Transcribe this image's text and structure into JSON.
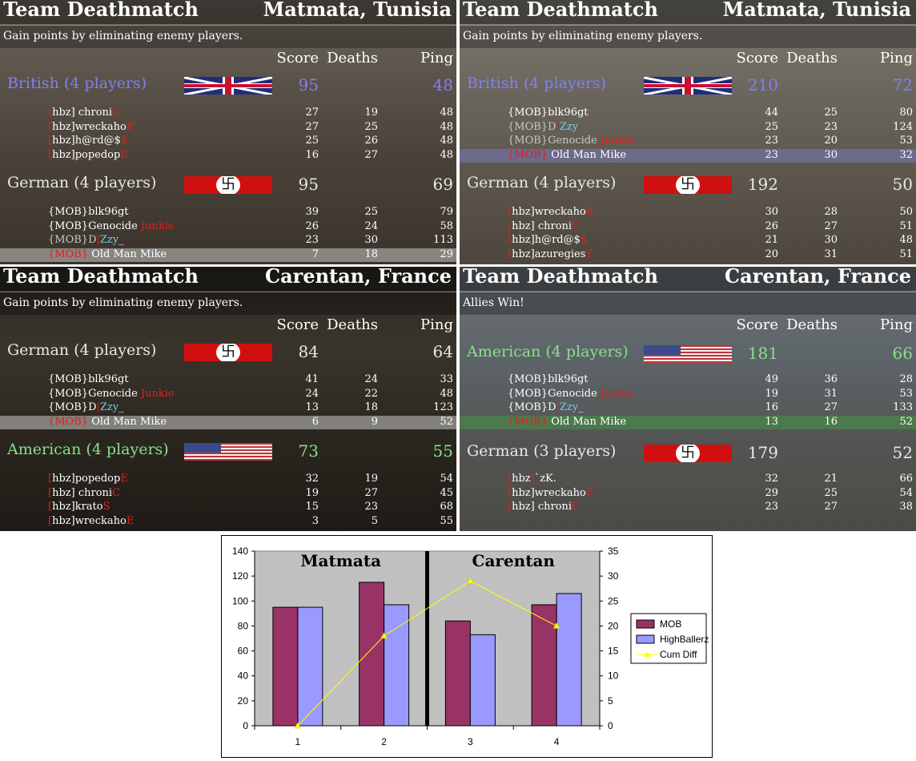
{
  "panels": [
    {
      "mode": "Team Deathmatch",
      "map": "Matmata, Tunisia",
      "subtitle": "Gain points by eliminating enemy players.",
      "cols": {
        "score": "Score",
        "deaths": "Deaths",
        "ping": "Ping"
      },
      "teams": [
        {
          "name": "British (4 players)",
          "color": "#8080f0",
          "flag": "uk",
          "score": "95",
          "ping": "48",
          "players": [
            {
              "parts": [
                [
                  "[",
                  "red"
                ],
                [
                  "hbz",
                  "wht"
                ],
                [
                  "] chroni",
                  "wht"
                ],
                [
                  "C",
                  "red"
                ]
              ],
              "score": "27",
              "deaths": "19",
              "ping": "48",
              "hl": ""
            },
            {
              "parts": [
                [
                  "[",
                  "red"
                ],
                [
                  "hbz",
                  "wht"
                ],
                [
                  "]wreckaho",
                  "wht"
                ],
                [
                  "E",
                  "red"
                ]
              ],
              "score": "27",
              "deaths": "25",
              "ping": "48",
              "hl": ""
            },
            {
              "parts": [
                [
                  "[",
                  "red"
                ],
                [
                  "hbz",
                  "wht"
                ],
                [
                  "]h@rd@$",
                  "wht"
                ],
                [
                  "$",
                  "red"
                ]
              ],
              "score": "25",
              "deaths": "26",
              "ping": "48",
              "hl": ""
            },
            {
              "parts": [
                [
                  "[",
                  "red"
                ],
                [
                  "hbz",
                  "wht"
                ],
                [
                  "]popedop",
                  "wht"
                ],
                [
                  "E",
                  "red"
                ]
              ],
              "score": "16",
              "deaths": "27",
              "ping": "48",
              "hl": ""
            }
          ]
        },
        {
          "name": "German (4 players)",
          "color": "#e8e8e8",
          "flag": "de",
          "score": "95",
          "ping": "69",
          "players": [
            {
              "parts": [
                [
                  "{MOB}blk96gt",
                  "wht"
                ]
              ],
              "score": "39",
              "deaths": "25",
              "ping": "79",
              "hl": ""
            },
            {
              "parts": [
                [
                  "{MOB}Genocide ",
                  "wht"
                ],
                [
                  "Junkie",
                  "red"
                ]
              ],
              "score": "26",
              "deaths": "24",
              "ping": "58",
              "hl": ""
            },
            {
              "parts": [
                [
                  "{MOB}D",
                  "gry"
                ],
                [
                  "|",
                  "red"
                ],
                [
                  "Zzy",
                  "cyan"
                ],
                [
                  "_",
                  "wht"
                ]
              ],
              "score": "23",
              "deaths": "30",
              "ping": "113",
              "hl": ""
            },
            {
              "parts": [
                [
                  "{MOB}",
                  "red"
                ],
                [
                  " Old Man Mike",
                  "wht"
                ]
              ],
              "score": "7",
              "deaths": "18",
              "ping": "29",
              "hl": "grey"
            }
          ]
        }
      ]
    },
    {
      "mode": "Team Deathmatch",
      "map": "Matmata, Tunisia",
      "subtitle": "Gain points by eliminating enemy players.",
      "cols": {
        "score": "Score",
        "deaths": "Deaths",
        "ping": "Ping"
      },
      "teams": [
        {
          "name": "British (4 players)",
          "color": "#8080f0",
          "flag": "uk",
          "score": "210",
          "ping": "72",
          "players": [
            {
              "parts": [
                [
                  "{MOB}blk96gt",
                  "wht"
                ]
              ],
              "score": "44",
              "deaths": "25",
              "ping": "80",
              "hl": ""
            },
            {
              "parts": [
                [
                  "{MOB}D",
                  "gry"
                ],
                [
                  "|",
                  "red"
                ],
                [
                  "Zzy",
                  "cyan"
                ]
              ],
              "score": "25",
              "deaths": "23",
              "ping": "124",
              "hl": ""
            },
            {
              "parts": [
                [
                  "{MOB}Genocide ",
                  "gry"
                ],
                [
                  "Junkie",
                  "red"
                ]
              ],
              "score": "23",
              "deaths": "20",
              "ping": "53",
              "hl": ""
            },
            {
              "parts": [
                [
                  "{MOB}",
                  "red"
                ],
                [
                  " Old Man Mike",
                  "wht"
                ]
              ],
              "score": "23",
              "deaths": "30",
              "ping": "32",
              "hl": "blue"
            }
          ]
        },
        {
          "name": "German (4 players)",
          "color": "#e8e8e8",
          "flag": "de",
          "score": "192",
          "ping": "50",
          "players": [
            {
              "parts": [
                [
                  "[",
                  "red"
                ],
                [
                  "hbz",
                  "wht"
                ],
                [
                  "]wreckaho",
                  "wht"
                ],
                [
                  "E",
                  "red"
                ]
              ],
              "score": "30",
              "deaths": "28",
              "ping": "50",
              "hl": ""
            },
            {
              "parts": [
                [
                  "[",
                  "red"
                ],
                [
                  "hbz",
                  "wht"
                ],
                [
                  "] chroni",
                  "wht"
                ],
                [
                  "C",
                  "red"
                ]
              ],
              "score": "26",
              "deaths": "27",
              "ping": "51",
              "hl": ""
            },
            {
              "parts": [
                [
                  "[",
                  "red"
                ],
                [
                  "hbz",
                  "wht"
                ],
                [
                  "]h@rd@$",
                  "wht"
                ],
                [
                  "$",
                  "red"
                ]
              ],
              "score": "21",
              "deaths": "30",
              "ping": "48",
              "hl": ""
            },
            {
              "parts": [
                [
                  "[",
                  "red"
                ],
                [
                  "hbz",
                  "wht"
                ],
                [
                  "]azuregies",
                  "wht"
                ],
                [
                  "T",
                  "red"
                ]
              ],
              "score": "20",
              "deaths": "31",
              "ping": "51",
              "hl": ""
            }
          ]
        }
      ]
    },
    {
      "mode": "Team Deathmatch",
      "map": "Carentan, France",
      "subtitle": "Gain points by eliminating enemy players.",
      "cols": {
        "score": "Score",
        "deaths": "Deaths",
        "ping": "Ping"
      },
      "teams": [
        {
          "name": "German (4 players)",
          "color": "#e8e8e8",
          "flag": "de",
          "score": "84",
          "ping": "64",
          "players": [
            {
              "parts": [
                [
                  "{MOB}blk96gt",
                  "wht"
                ]
              ],
              "score": "41",
              "deaths": "24",
              "ping": "33",
              "hl": ""
            },
            {
              "parts": [
                [
                  "{MOB}Genocide ",
                  "wht"
                ],
                [
                  "Junkie",
                  "red"
                ]
              ],
              "score": "24",
              "deaths": "22",
              "ping": "48",
              "hl": ""
            },
            {
              "parts": [
                [
                  "{MOB}D",
                  "wht"
                ],
                [
                  "|",
                  "red"
                ],
                [
                  "Zzy",
                  "cyan"
                ],
                [
                  "_",
                  "wht"
                ]
              ],
              "score": "13",
              "deaths": "18",
              "ping": "123",
              "hl": ""
            },
            {
              "parts": [
                [
                  "{MOB}",
                  "red"
                ],
                [
                  " Old Man Mike",
                  "wht"
                ]
              ],
              "score": "6",
              "deaths": "9",
              "ping": "52",
              "hl": "grey"
            }
          ]
        },
        {
          "name": "American (4 players)",
          "color": "#88e088",
          "flag": "us",
          "score": "73",
          "ping": "55",
          "players": [
            {
              "parts": [
                [
                  "[",
                  "red"
                ],
                [
                  "hbz",
                  "wht"
                ],
                [
                  "]popedop",
                  "wht"
                ],
                [
                  "E",
                  "red"
                ]
              ],
              "score": "32",
              "deaths": "19",
              "ping": "54",
              "hl": ""
            },
            {
              "parts": [
                [
                  "[",
                  "red"
                ],
                [
                  "hbz",
                  "wht"
                ],
                [
                  "] chroni",
                  "wht"
                ],
                [
                  "C",
                  "red"
                ]
              ],
              "score": "19",
              "deaths": "27",
              "ping": "45",
              "hl": ""
            },
            {
              "parts": [
                [
                  "[",
                  "red"
                ],
                [
                  "hbz",
                  "wht"
                ],
                [
                  "]krato",
                  "wht"
                ],
                [
                  "S",
                  "red"
                ]
              ],
              "score": "15",
              "deaths": "23",
              "ping": "68",
              "hl": ""
            },
            {
              "parts": [
                [
                  "[",
                  "red"
                ],
                [
                  "hbz",
                  "wht"
                ],
                [
                  "]wreckaho",
                  "wht"
                ],
                [
                  "E",
                  "red"
                ]
              ],
              "score": "3",
              "deaths": "5",
              "ping": "55",
              "hl": ""
            }
          ]
        }
      ]
    },
    {
      "mode": "Team Deathmatch",
      "map": "Carentan, France",
      "subtitle": "Allies Win!",
      "cols": {
        "score": "Score",
        "deaths": "Deaths",
        "ping": "Ping"
      },
      "teams": [
        {
          "name": "American (4 players)",
          "color": "#88e088",
          "flag": "us",
          "score": "181",
          "ping": "66",
          "players": [
            {
              "parts": [
                [
                  "{MOB}blk96gt",
                  "wht"
                ]
              ],
              "score": "49",
              "deaths": "36",
              "ping": "28",
              "hl": ""
            },
            {
              "parts": [
                [
                  "{MOB}Genocide ",
                  "wht"
                ],
                [
                  "Junkie",
                  "red"
                ]
              ],
              "score": "19",
              "deaths": "31",
              "ping": "53",
              "hl": ""
            },
            {
              "parts": [
                [
                  "{MOB}D",
                  "wht"
                ],
                [
                  "|",
                  "red"
                ],
                [
                  "Zzy",
                  "cyan"
                ],
                [
                  "_",
                  "wht"
                ]
              ],
              "score": "16",
              "deaths": "27",
              "ping": "133",
              "hl": ""
            },
            {
              "parts": [
                [
                  "{MOB}",
                  "red"
                ],
                [
                  " Old Man Mike",
                  "wht"
                ]
              ],
              "score": "13",
              "deaths": "16",
              "ping": "52",
              "hl": "green"
            }
          ]
        },
        {
          "name": "German (3 players)",
          "color": "#e8e8e8",
          "flag": "de",
          "score": "179",
          "ping": "52",
          "players": [
            {
              "parts": [
                [
                  "[",
                  "red"
                ],
                [
                  "hbz",
                  "wht"
                ],
                [
                  "]",
                  "red"
                ],
                [
                  "`zK.",
                  "wht"
                ]
              ],
              "score": "32",
              "deaths": "21",
              "ping": "66",
              "hl": ""
            },
            {
              "parts": [
                [
                  "[",
                  "red"
                ],
                [
                  "hbz",
                  "wht"
                ],
                [
                  "]wreckaho",
                  "wht"
                ],
                [
                  "E",
                  "red"
                ]
              ],
              "score": "29",
              "deaths": "25",
              "ping": "54",
              "hl": ""
            },
            {
              "parts": [
                [
                  "[",
                  "red"
                ],
                [
                  "hbz",
                  "wht"
                ],
                [
                  "] chroni",
                  "wht"
                ],
                [
                  "C",
                  "red"
                ]
              ],
              "score": "23",
              "deaths": "27",
              "ping": "38",
              "hl": ""
            }
          ]
        }
      ]
    }
  ],
  "chart_data": {
    "type": "bar",
    "categories": [
      "1",
      "2",
      "3",
      "4"
    ],
    "series": [
      {
        "name": "MOB",
        "values": [
          95,
          115,
          84,
          97
        ],
        "color": "#993366",
        "axis": "left"
      },
      {
        "name": "HighBallerz",
        "values": [
          95,
          97,
          73,
          106
        ],
        "color": "#9999ff",
        "axis": "left"
      },
      {
        "name": "Cum Diff",
        "values": [
          0,
          18,
          29,
          20
        ],
        "color": "#ffff00",
        "axis": "right",
        "type": "line"
      }
    ],
    "ylim_left": [
      0,
      140
    ],
    "yticks_left": [
      0,
      20,
      40,
      60,
      80,
      100,
      120,
      140
    ],
    "ylim_right": [
      0,
      35
    ],
    "yticks_right": [
      0,
      5,
      10,
      15,
      20,
      25,
      30,
      35
    ],
    "annotations": [
      "Matmata",
      "Carentan"
    ],
    "plot_background": "#c0c0c0",
    "legend_position": "right"
  }
}
